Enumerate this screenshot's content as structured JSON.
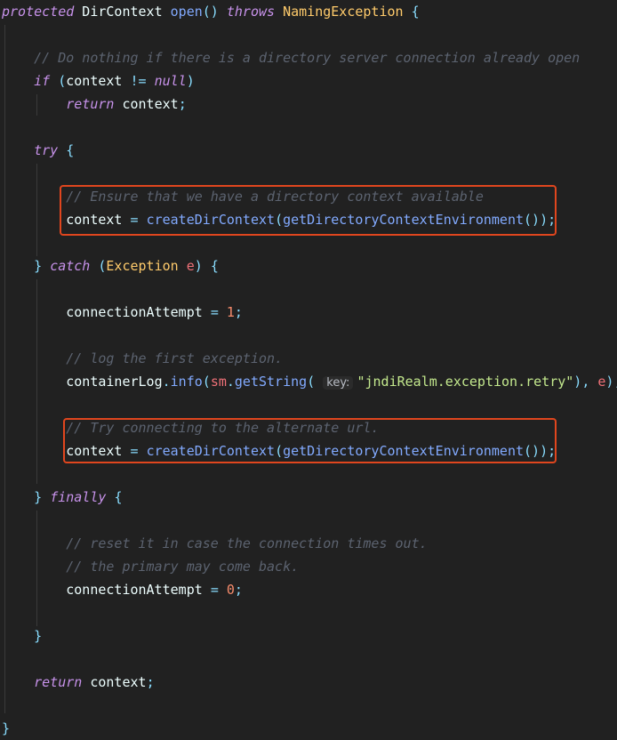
{
  "editor": {
    "lines": [
      [
        [
          "kw",
          "protected"
        ],
        [
          "plain",
          " DirContext "
        ],
        [
          "fn",
          "open"
        ],
        [
          "pun",
          "()"
        ],
        [
          "plain",
          " "
        ],
        [
          "kw",
          "throws"
        ],
        [
          "plain",
          " "
        ],
        [
          "exc",
          "NamingException"
        ],
        [
          "plain",
          " "
        ],
        [
          "pun",
          "{"
        ]
      ],
      [],
      [
        [
          "plain",
          "    "
        ],
        [
          "cm",
          "// Do nothing if there is a directory server connection already open"
        ]
      ],
      [
        [
          "plain",
          "    "
        ],
        [
          "kw",
          "if"
        ],
        [
          "plain",
          " "
        ],
        [
          "pun",
          "("
        ],
        [
          "plain",
          "context "
        ],
        [
          "op",
          "!="
        ],
        [
          "plain",
          " "
        ],
        [
          "kw",
          "null"
        ],
        [
          "pun",
          ")"
        ]
      ],
      [
        [
          "plain",
          "        "
        ],
        [
          "kw",
          "return"
        ],
        [
          "plain",
          " context"
        ],
        [
          "pun",
          ";"
        ]
      ],
      [],
      [
        [
          "plain",
          "    "
        ],
        [
          "kw",
          "try"
        ],
        [
          "plain",
          " "
        ],
        [
          "pun",
          "{"
        ]
      ],
      [],
      [
        [
          "plain",
          "        "
        ],
        [
          "cm",
          "// Ensure that we have a directory context available"
        ]
      ],
      [
        [
          "plain",
          "        context "
        ],
        [
          "op",
          "="
        ],
        [
          "plain",
          " "
        ],
        [
          "fn",
          "createDirContext"
        ],
        [
          "pun",
          "("
        ],
        [
          "fn",
          "getDirectoryContextEnvironment"
        ],
        [
          "pun",
          "());"
        ]
      ],
      [],
      [
        [
          "plain",
          "    "
        ],
        [
          "pun",
          "}"
        ],
        [
          "plain",
          " "
        ],
        [
          "kw",
          "catch"
        ],
        [
          "plain",
          " "
        ],
        [
          "pun",
          "("
        ],
        [
          "exc",
          "Exception"
        ],
        [
          "plain",
          " "
        ],
        [
          "var",
          "e"
        ],
        [
          "pun",
          ")"
        ],
        [
          "plain",
          " "
        ],
        [
          "pun",
          "{"
        ]
      ],
      [],
      [
        [
          "plain",
          "        connectionAttempt "
        ],
        [
          "op",
          "="
        ],
        [
          "plain",
          " "
        ],
        [
          "num",
          "1"
        ],
        [
          "pun",
          ";"
        ]
      ],
      [],
      [
        [
          "plain",
          "        "
        ],
        [
          "cm",
          "// log the first exception."
        ]
      ],
      [
        [
          "plain",
          "        containerLog"
        ],
        [
          "pun",
          "."
        ],
        [
          "fn",
          "info"
        ],
        [
          "pun",
          "("
        ],
        [
          "var",
          "sm"
        ],
        [
          "pun",
          "."
        ],
        [
          "fn",
          "getString"
        ],
        [
          "pun",
          "("
        ],
        [
          "plain",
          " "
        ],
        [
          "hint",
          "key:"
        ],
        [
          "str",
          "\"jndiRealm.exception.retry\""
        ],
        [
          "pun",
          "),"
        ],
        [
          "plain",
          " "
        ],
        [
          "var",
          "e"
        ],
        [
          "pun",
          ");"
        ]
      ],
      [],
      [
        [
          "plain",
          "        "
        ],
        [
          "cm",
          "// Try connecting to the alternate url."
        ]
      ],
      [
        [
          "plain",
          "        context "
        ],
        [
          "op",
          "="
        ],
        [
          "plain",
          " "
        ],
        [
          "fn",
          "createDirContext"
        ],
        [
          "pun",
          "("
        ],
        [
          "fn",
          "getDirectoryContextEnvironment"
        ],
        [
          "pun",
          "());"
        ]
      ],
      [],
      [
        [
          "plain",
          "    "
        ],
        [
          "pun",
          "}"
        ],
        [
          "plain",
          " "
        ],
        [
          "kw",
          "finally"
        ],
        [
          "plain",
          " "
        ],
        [
          "pun",
          "{"
        ]
      ],
      [],
      [
        [
          "plain",
          "        "
        ],
        [
          "cm",
          "// reset it in case the connection times out."
        ]
      ],
      [
        [
          "plain",
          "        "
        ],
        [
          "cm",
          "// the primary may come back."
        ]
      ],
      [
        [
          "plain",
          "        connectionAttempt "
        ],
        [
          "op",
          "="
        ],
        [
          "plain",
          " "
        ],
        [
          "num",
          "0"
        ],
        [
          "pun",
          ";"
        ]
      ],
      [],
      [
        [
          "plain",
          "    "
        ],
        [
          "pun",
          "}"
        ]
      ],
      [],
      [
        [
          "plain",
          "    "
        ],
        [
          "kw",
          "return"
        ],
        [
          "plain",
          " context"
        ],
        [
          "pun",
          ";"
        ]
      ],
      [],
      [
        [
          "pun",
          "}"
        ]
      ]
    ]
  },
  "colors": {
    "highlight_box": "#e0461e",
    "background": "#212121"
  }
}
